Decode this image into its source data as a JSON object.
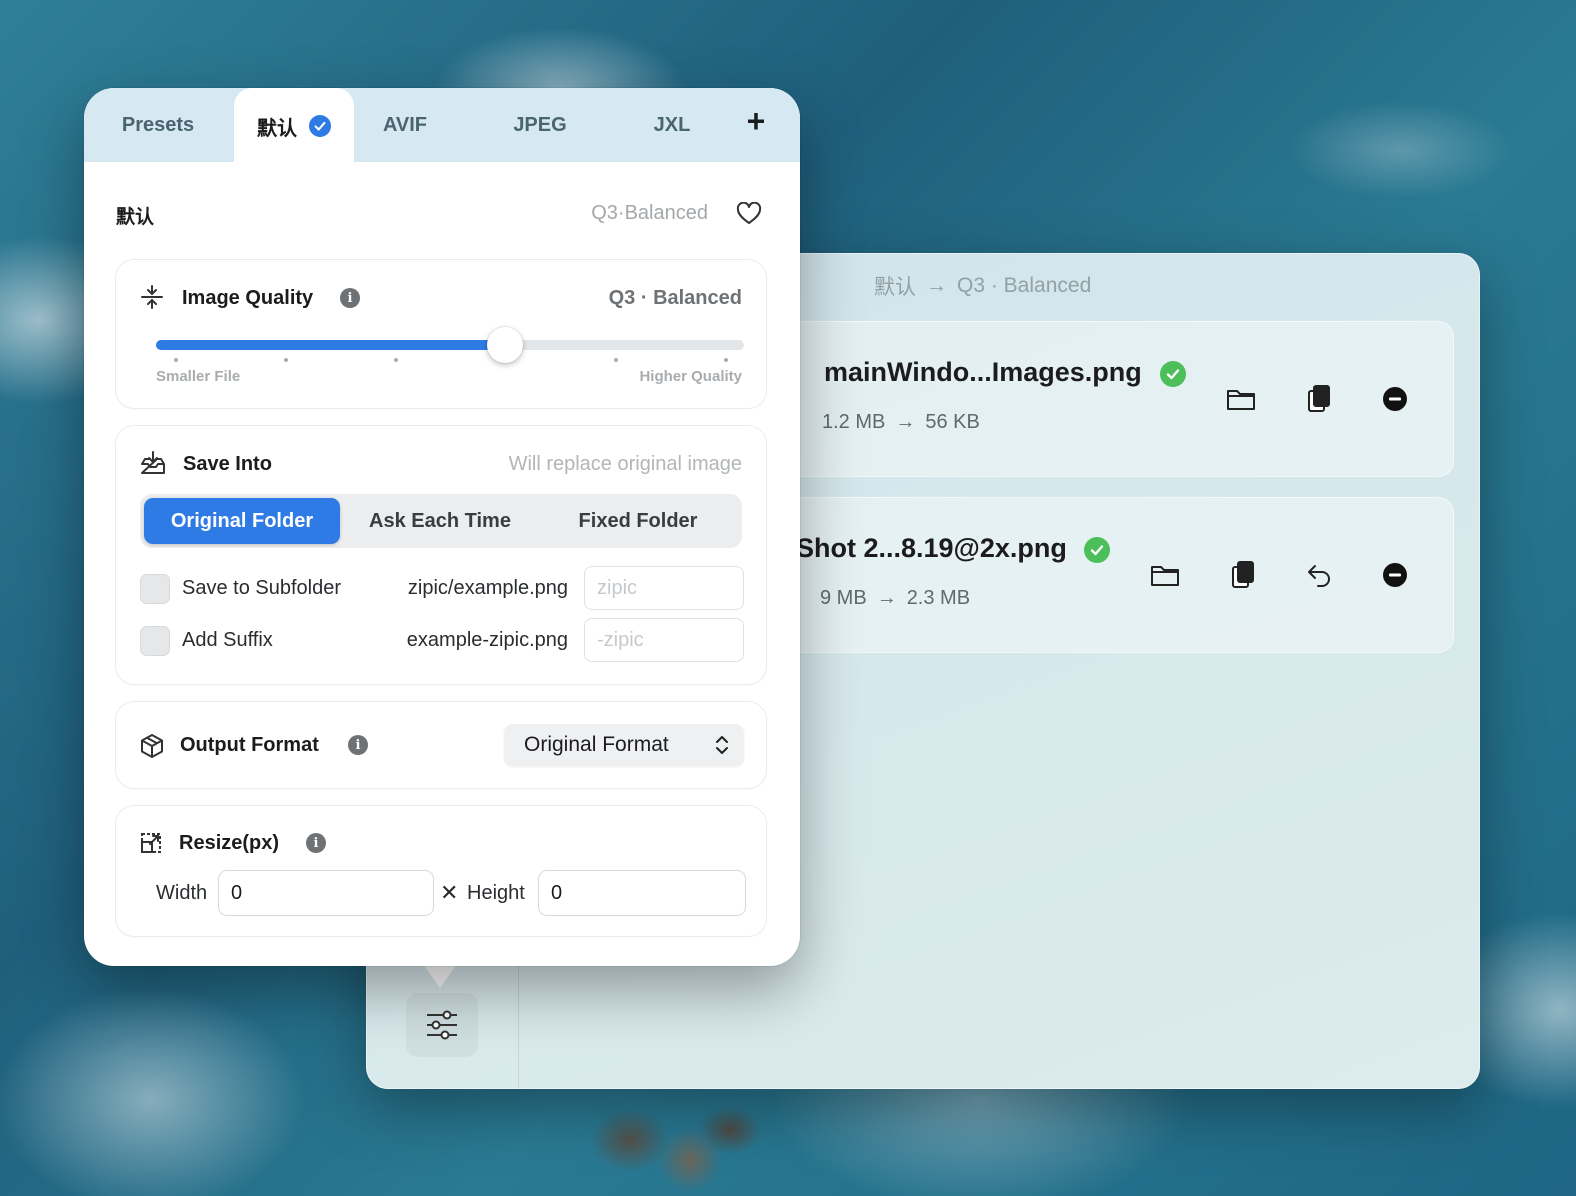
{
  "main_window": {
    "breadcrumb": {
      "preset": "默认",
      "arrow": "→",
      "quality": "Q3 · Balanced"
    },
    "files": [
      {
        "name": "mainWindo...Images.png",
        "original_size": "1.2 MB",
        "arrow": "→",
        "compressed_size": "56 KB",
        "status": "done"
      },
      {
        "name": "Shot 2...8.19@2x.png",
        "original_size": "9 MB",
        "arrow": "→",
        "compressed_size": "2.3 MB",
        "status": "done"
      }
    ]
  },
  "popover": {
    "tabs": [
      {
        "label": "Presets"
      },
      {
        "label": "默认",
        "active": true
      },
      {
        "label": "AVIF"
      },
      {
        "label": "JPEG"
      },
      {
        "label": "JXL"
      }
    ],
    "add_tab_label": "+",
    "preset": {
      "name": "默认",
      "summary": "Q3·Balanced",
      "favorite": false
    },
    "image_quality": {
      "title": "Image Quality",
      "value_label": "Q3 · Balanced",
      "level": 0.594,
      "min_label": "Smaller File",
      "max_label": "Higher Quality"
    },
    "save_into": {
      "title": "Save Into",
      "hint": "Will replace original image",
      "options": [
        "Original Folder",
        "Ask Each Time",
        "Fixed Folder"
      ],
      "selected": "Original Folder",
      "subfolder": {
        "label": "Save to Subfolder",
        "example": "zipic/example.png",
        "placeholder": "zipic",
        "value": "",
        "checked": false
      },
      "suffix": {
        "label": "Add Suffix",
        "example": "example-zipic.png",
        "placeholder": "-zipic",
        "value": "",
        "checked": false
      }
    },
    "output_format": {
      "title": "Output Format",
      "selected": "Original Format"
    },
    "resize": {
      "title": "Resize(px)",
      "width_label": "Width",
      "width_value": "0",
      "times": "✕",
      "height_label": "Height",
      "height_value": "0"
    }
  },
  "colors": {
    "accent": "#2f7be6",
    "success": "#4cbf5a",
    "tabbar": "#d6e9f2"
  },
  "icons": [
    "info-icon",
    "heart-icon",
    "check-icon",
    "folder-icon",
    "copy-icon",
    "undo-icon",
    "remove-icon",
    "sliders-icon",
    "quality-icon",
    "tray-icon",
    "cube-icon",
    "resize-icon",
    "chevron-updown-icon",
    "plus-icon"
  ]
}
